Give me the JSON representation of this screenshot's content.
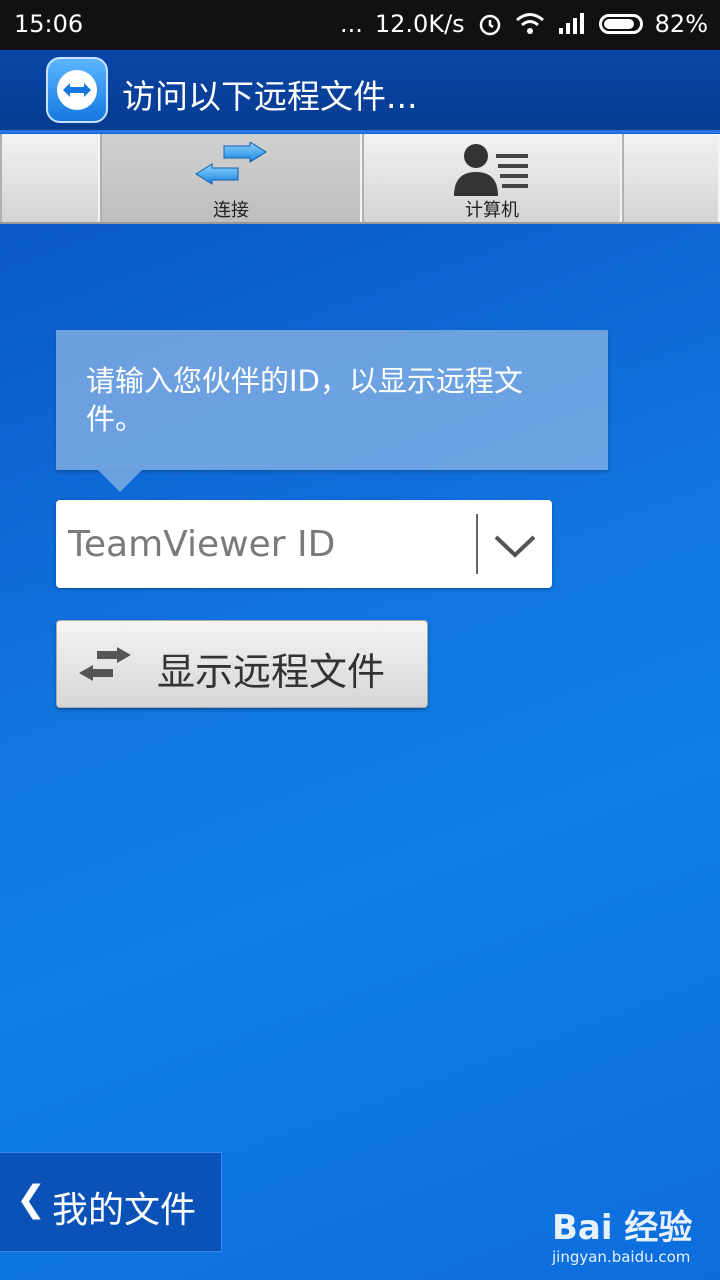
{
  "status_bar": {
    "time": "15:06",
    "speed": "12.0K/s",
    "battery": "82%",
    "signal_dots": "..."
  },
  "app_bar": {
    "title": "访问以下远程文件..."
  },
  "tabs": [
    {
      "label": "连接",
      "icon": "connect-arrows-icon",
      "active": true
    },
    {
      "label": "计算机",
      "icon": "contact-list-icon",
      "active": false
    }
  ],
  "main": {
    "tooltip_text": "请输入您伙伴的ID，以显示远程文件。",
    "id_input": {
      "placeholder": "TeamViewer ID",
      "value": ""
    },
    "show_button_label": "显示远程文件",
    "my_files_label": "我的文件",
    "my_files_chevron": "❮"
  },
  "watermark": {
    "brand": "Bai 经验",
    "url": "jingyan.baidu.com"
  },
  "colors": {
    "app_bar": "#0a47a8",
    "background": "#0f7ee8",
    "status_bar": "#111111"
  }
}
